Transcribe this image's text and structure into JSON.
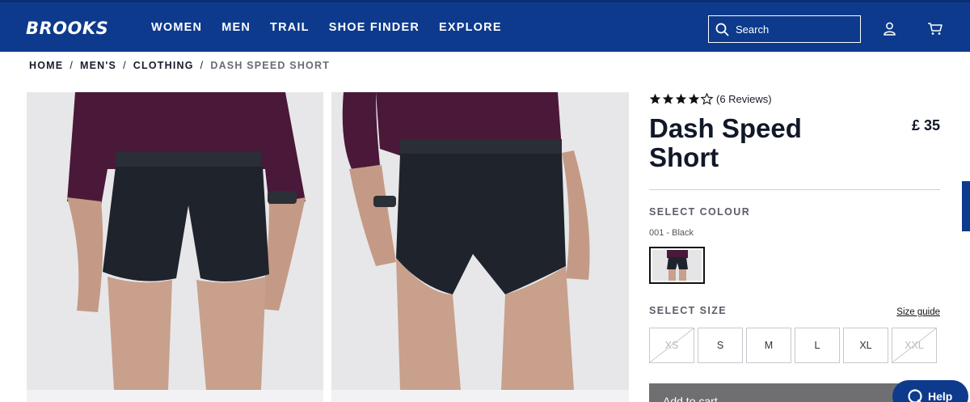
{
  "header": {
    "logo": "BROOKS",
    "nav": [
      "WOMEN",
      "MEN",
      "TRAIL",
      "SHOE FINDER",
      "EXPLORE"
    ],
    "search_placeholder": "Search",
    "icons": [
      "search-icon",
      "account-icon",
      "cart-icon"
    ]
  },
  "breadcrumb": {
    "items": [
      "HOME",
      "MEN'S",
      "CLOTHING"
    ],
    "separator": "/",
    "current": "DASH SPEED SHORT"
  },
  "product": {
    "rating": 4.5,
    "stars_max": 5,
    "reviews_label": "(6 Reviews)",
    "name": "Dash Speed Short",
    "price": "£ 35",
    "select_colour_label": "SELECT COLOUR",
    "colour_value": "001 - Black",
    "select_size_label": "SELECT SIZE",
    "size_guide_label": "Size guide",
    "sizes": [
      {
        "label": "XS",
        "available": false
      },
      {
        "label": "S",
        "available": true
      },
      {
        "label": "M",
        "available": true
      },
      {
        "label": "L",
        "available": true
      },
      {
        "label": "XL",
        "available": true
      },
      {
        "label": "XXL",
        "available": false
      }
    ],
    "add_to_cart_label": "Add to cart"
  },
  "help": {
    "label": "Help"
  },
  "colors": {
    "brand_blue": "#0d3a8c",
    "shorts_black": "#1f232c",
    "shirt_purple": "#4a1838",
    "button_gray": "#6f6f72"
  }
}
